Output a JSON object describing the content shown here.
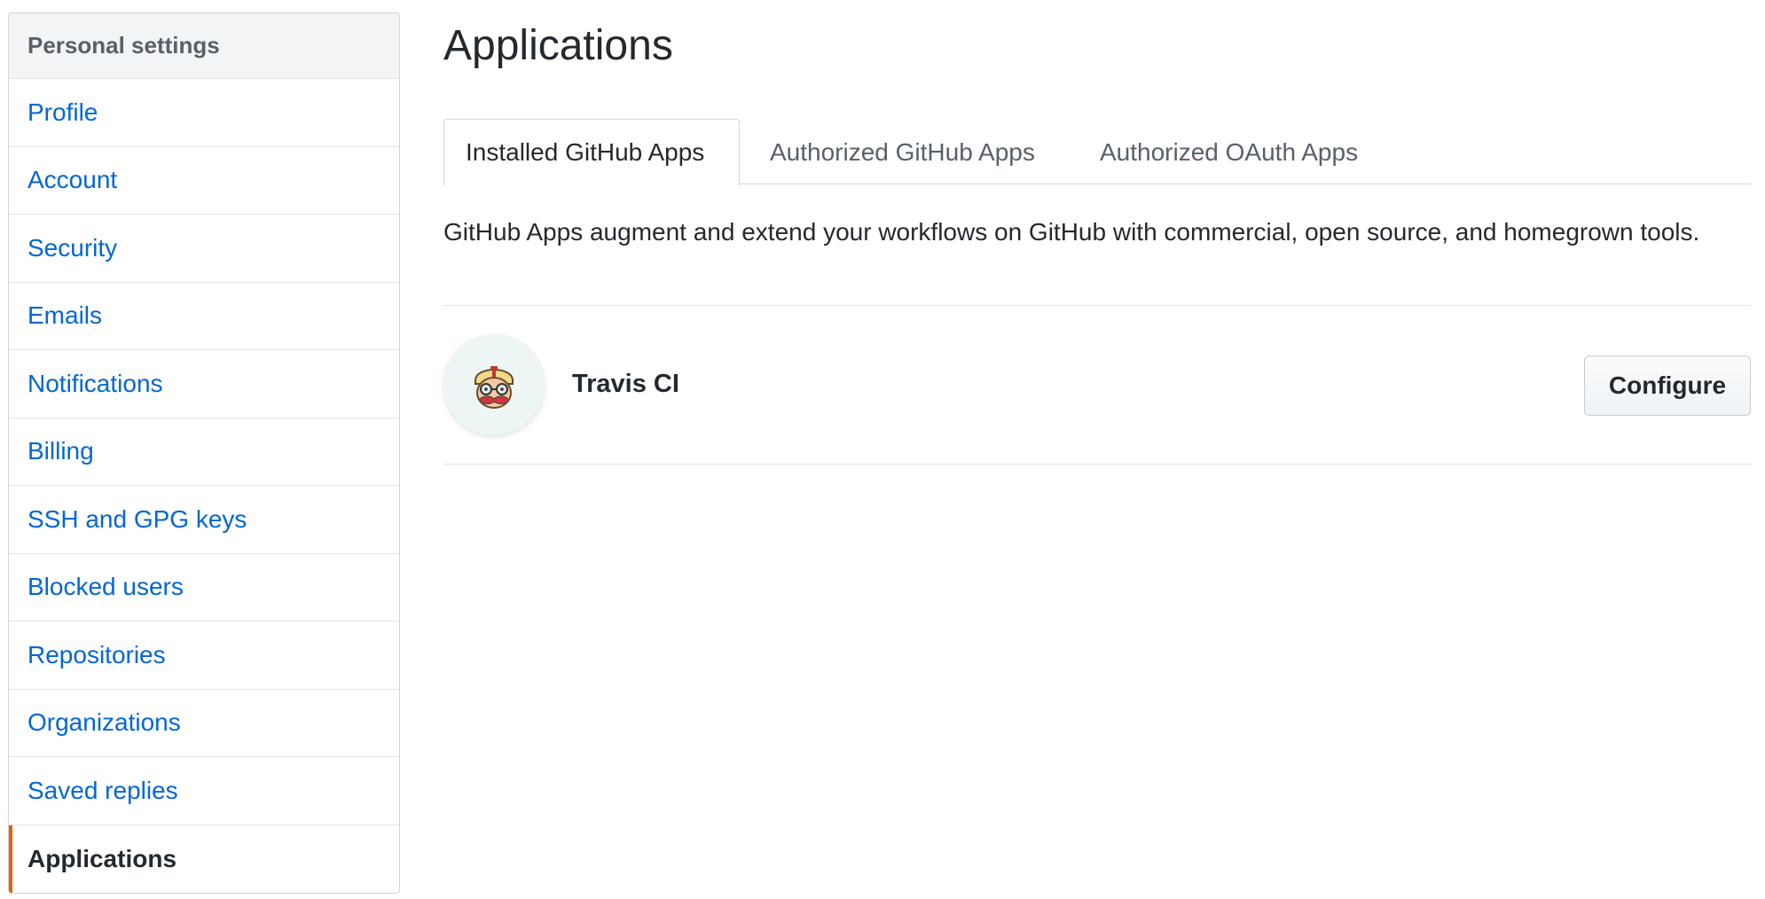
{
  "sidebar": {
    "header": "Personal settings",
    "items": [
      {
        "label": "Profile"
      },
      {
        "label": "Account"
      },
      {
        "label": "Security"
      },
      {
        "label": "Emails"
      },
      {
        "label": "Notifications"
      },
      {
        "label": "Billing"
      },
      {
        "label": "SSH and GPG keys"
      },
      {
        "label": "Blocked users"
      },
      {
        "label": "Repositories"
      },
      {
        "label": "Organizations"
      },
      {
        "label": "Saved replies"
      },
      {
        "label": "Applications",
        "selected": true
      }
    ]
  },
  "main": {
    "title": "Applications",
    "tabs": [
      {
        "label": "Installed GitHub Apps",
        "active": true
      },
      {
        "label": "Authorized GitHub Apps"
      },
      {
        "label": "Authorized OAuth Apps"
      }
    ],
    "description": "GitHub Apps augment and extend your workflows on GitHub with commercial, open source, and homegrown tools.",
    "apps": [
      {
        "name": "Travis CI",
        "icon": "travis-ci-mascot-icon",
        "action_label": "Configure"
      }
    ]
  },
  "colors": {
    "link": "#0366d6",
    "selected_indicator": "#e36209",
    "text": "#24292e",
    "muted": "#586069",
    "border": "#d1d5da"
  }
}
